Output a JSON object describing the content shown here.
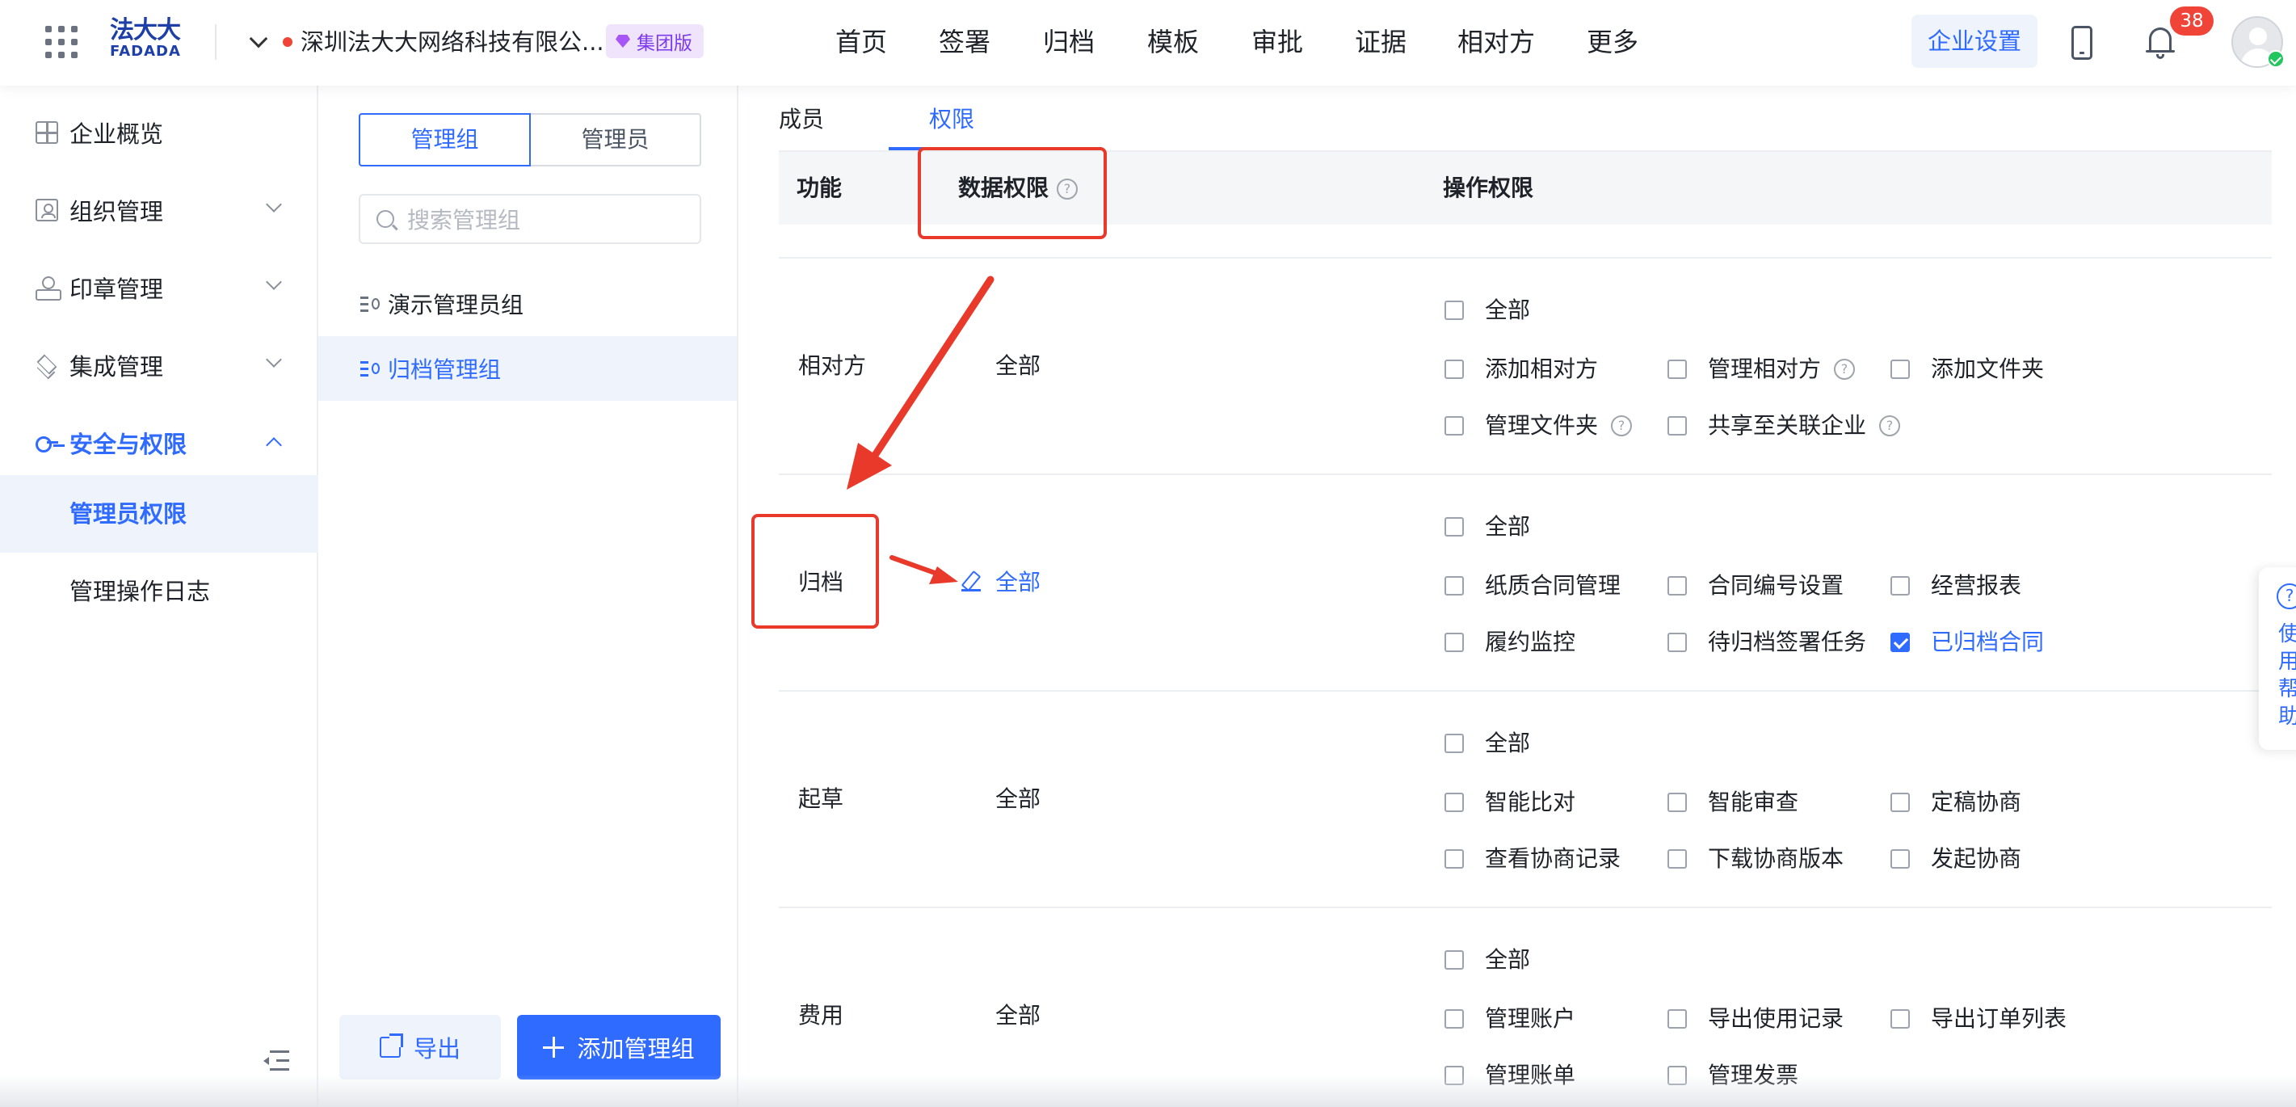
{
  "header": {
    "logo_cn": "法大大",
    "logo_en": "FADADA",
    "company_name": "深圳法大大网络科技有限公...",
    "edition_badge": "集团版",
    "nav": [
      "首页",
      "签署",
      "归档",
      "模板",
      "审批",
      "证据",
      "相对方",
      "更多"
    ],
    "settings_button": "企业设置",
    "notification_count": "38",
    "colors": {
      "accent": "#2f6bff",
      "badge": "#f04438",
      "edition": "#7c3aed"
    }
  },
  "sidebar": {
    "items": [
      {
        "label": "企业概览",
        "icon": "dashboard-icon"
      },
      {
        "label": "组织管理",
        "icon": "org-icon"
      },
      {
        "label": "印章管理",
        "icon": "seal-icon"
      },
      {
        "label": "集成管理",
        "icon": "layers-icon"
      },
      {
        "label": "安全与权限",
        "icon": "key-icon"
      }
    ],
    "sub_items": [
      "管理员权限",
      "管理操作日志"
    ]
  },
  "middle": {
    "segments": [
      "管理组",
      "管理员"
    ],
    "search_placeholder": "搜索管理组",
    "groups": [
      "演示管理员组",
      "归档管理组"
    ],
    "export_button": "导出",
    "add_button": "添加管理组"
  },
  "content": {
    "tabs": [
      "成员",
      "权限"
    ],
    "columns": {
      "function": "功能",
      "data_permission": "数据权限",
      "operation_permission": "操作权限",
      "help_glyph": "?"
    },
    "rows": [
      {
        "function": "相对方",
        "data": "全部",
        "options": [
          {
            "label": "全部",
            "checked": false
          },
          {
            "label": "添加相对方",
            "checked": false
          },
          {
            "label": "管理相对方",
            "checked": false
          },
          {
            "label": "添加文件夹",
            "checked": false
          },
          {
            "label": "管理文件夹",
            "checked": false
          },
          {
            "label": "共享至关联企业",
            "checked": false
          }
        ]
      },
      {
        "function": "归档",
        "data": "全部",
        "options": [
          {
            "label": "全部",
            "checked": false
          },
          {
            "label": "纸质合同管理",
            "checked": false
          },
          {
            "label": "合同编号设置",
            "checked": false
          },
          {
            "label": "经营报表",
            "checked": false
          },
          {
            "label": "履约监控",
            "checked": false
          },
          {
            "label": "待归档签署任务",
            "checked": false
          },
          {
            "label": "已归档合同",
            "checked": true
          }
        ]
      },
      {
        "function": "起草",
        "data": "全部",
        "options": [
          {
            "label": "全部",
            "checked": false
          },
          {
            "label": "智能比对",
            "checked": false
          },
          {
            "label": "智能审查",
            "checked": false
          },
          {
            "label": "定稿协商",
            "checked": false
          },
          {
            "label": "查看协商记录",
            "checked": false
          },
          {
            "label": "下载协商版本",
            "checked": false
          },
          {
            "label": "发起协商",
            "checked": false
          }
        ]
      },
      {
        "function": "费用",
        "data": "全部",
        "options": [
          {
            "label": "全部",
            "checked": false
          },
          {
            "label": "管理账户",
            "checked": false
          },
          {
            "label": "导出使用记录",
            "checked": false
          },
          {
            "label": "导出订单列表",
            "checked": false
          },
          {
            "label": "管理账单",
            "checked": false
          },
          {
            "label": "管理发票",
            "checked": false
          }
        ]
      }
    ]
  },
  "help_widget": {
    "glyph": "?",
    "text": "使用帮助"
  },
  "annotation_color": "#e8392b"
}
